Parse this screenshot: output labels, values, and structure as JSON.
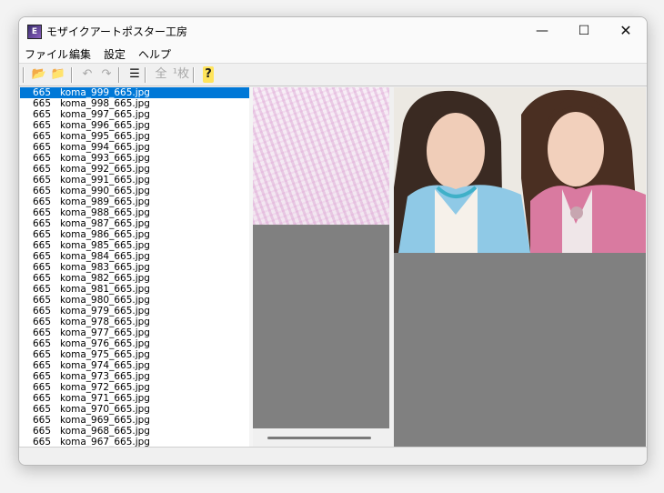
{
  "window": {
    "title": "モザイクアートポスター工房",
    "icon_letter": "E"
  },
  "titlebar_controls": {
    "minimize": "—",
    "maximize": "☐",
    "close": "✕"
  },
  "menu": [
    "ファイル",
    "編集",
    "設定",
    "ヘルプ"
  ],
  "toolbar": {
    "buttons": [
      {
        "name": "open-folder-icon",
        "glyph": "📂",
        "enabled": true
      },
      {
        "name": "new-folder-icon",
        "glyph": "📁",
        "enabled": true
      },
      {
        "name": "undo-icon",
        "glyph": "↶",
        "enabled": false
      },
      {
        "name": "redo-icon",
        "glyph": "↷",
        "enabled": false
      },
      {
        "name": "list-view-icon",
        "glyph": "☰",
        "enabled": true
      },
      {
        "name": "all-icon",
        "glyph": "全",
        "enabled": false
      },
      {
        "name": "one-sheet-icon",
        "glyph": "¹枚",
        "enabled": false
      },
      {
        "name": "help-icon",
        "glyph": "?",
        "enabled": true
      }
    ]
  },
  "file_list": {
    "selected_index": 0,
    "rows": [
      {
        "num": "665",
        "name": "koma_999_665.jpg"
      },
      {
        "num": "665",
        "name": "koma_998_665.jpg"
      },
      {
        "num": "665",
        "name": "koma_997_665.jpg"
      },
      {
        "num": "665",
        "name": "koma_996_665.jpg"
      },
      {
        "num": "665",
        "name": "koma_995_665.jpg"
      },
      {
        "num": "665",
        "name": "koma_994_665.jpg"
      },
      {
        "num": "665",
        "name": "koma_993_665.jpg"
      },
      {
        "num": "665",
        "name": "koma_992_665.jpg"
      },
      {
        "num": "665",
        "name": "koma_991_665.jpg"
      },
      {
        "num": "665",
        "name": "koma_990_665.jpg"
      },
      {
        "num": "665",
        "name": "koma_989_665.jpg"
      },
      {
        "num": "665",
        "name": "koma_988_665.jpg"
      },
      {
        "num": "665",
        "name": "koma_987_665.jpg"
      },
      {
        "num": "665",
        "name": "koma_986_665.jpg"
      },
      {
        "num": "665",
        "name": "koma_985_665.jpg"
      },
      {
        "num": "665",
        "name": "koma_984_665.jpg"
      },
      {
        "num": "665",
        "name": "koma_983_665.jpg"
      },
      {
        "num": "665",
        "name": "koma_982_665.jpg"
      },
      {
        "num": "665",
        "name": "koma_981_665.jpg"
      },
      {
        "num": "665",
        "name": "koma_980_665.jpg"
      },
      {
        "num": "665",
        "name": "koma_979_665.jpg"
      },
      {
        "num": "665",
        "name": "koma_978_665.jpg"
      },
      {
        "num": "665",
        "name": "koma_977_665.jpg"
      },
      {
        "num": "665",
        "name": "koma_976_665.jpg"
      },
      {
        "num": "665",
        "name": "koma_975_665.jpg"
      },
      {
        "num": "665",
        "name": "koma_974_665.jpg"
      },
      {
        "num": "665",
        "name": "koma_973_665.jpg"
      },
      {
        "num": "665",
        "name": "koma_972_665.jpg"
      },
      {
        "num": "665",
        "name": "koma_971_665.jpg"
      },
      {
        "num": "665",
        "name": "koma_970_665.jpg"
      },
      {
        "num": "665",
        "name": "koma_969_665.jpg"
      },
      {
        "num": "665",
        "name": "koma_968_665.jpg"
      },
      {
        "num": "665",
        "name": "koma_967_665.jpg"
      }
    ]
  },
  "colors": {
    "selection": "#0078d7",
    "pane_background": "#808080"
  }
}
